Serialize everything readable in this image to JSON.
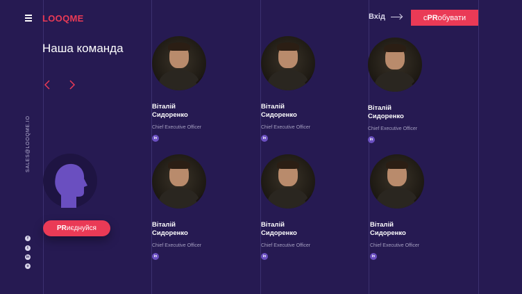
{
  "header": {
    "logo": "LOOQME",
    "login_label": "Вхід",
    "try_prefix": "с",
    "try_highlight": "PR",
    "try_suffix": "обувати"
  },
  "section": {
    "title": "Наша команда"
  },
  "sidebar": {
    "email": "SALES@LOOQME.IO",
    "socials": [
      "facebook-icon",
      "twitter-icon",
      "linkedin-icon",
      "instagram-icon"
    ]
  },
  "join": {
    "highlight": "PR",
    "suffix": "иєднуйся"
  },
  "members": [
    {
      "first": "Віталій",
      "last": "Сидоренко",
      "role": "Chief Executive Officer",
      "social": "in"
    },
    {
      "first": "Віталій",
      "last": "Сидоренко",
      "role": "Chief Executive Officer",
      "social": "in"
    },
    {
      "first": "Віталій",
      "last": "Сидоренко",
      "role": "Chief Executive Officer",
      "social": "in"
    },
    {
      "first": "Віталій",
      "last": "Сидоренко",
      "role": "Chief Executive Officer",
      "social": "in"
    },
    {
      "first": "Віталій",
      "last": "Сидоренко",
      "role": "Chief Executive Officer",
      "social": "in"
    },
    {
      "first": "Віталій",
      "last": "Сидоренко",
      "role": "Chief Executive Officer",
      "social": "in"
    }
  ],
  "colors": {
    "background": "#261a52",
    "accent": "#ea3a56",
    "avatar_placeholder": "#6a4fc0"
  }
}
